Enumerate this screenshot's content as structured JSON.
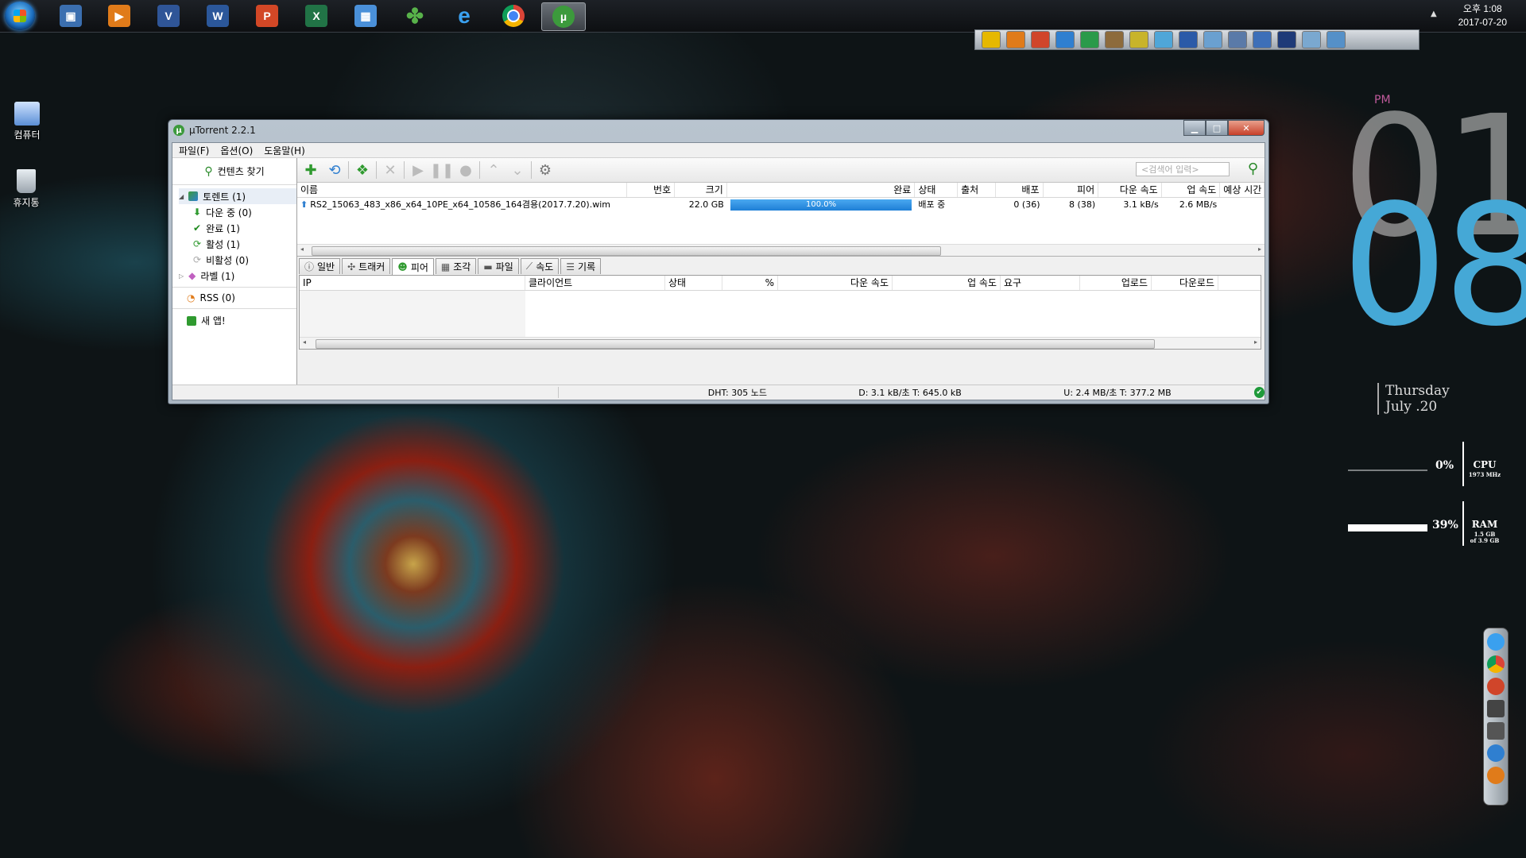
{
  "taskbar": {
    "clock_time": "오후 1:08",
    "clock_date": "2017-07-20",
    "pinned": [
      {
        "name": "computer",
        "glyph": "▣",
        "color": "#3b6fb0"
      },
      {
        "name": "media-player",
        "glyph": "▶",
        "color": "#e07b1a"
      },
      {
        "name": "visio",
        "glyph": "V",
        "color": "#2f5597"
      },
      {
        "name": "word",
        "glyph": "W",
        "color": "#2b579a"
      },
      {
        "name": "powerpoint",
        "glyph": "P",
        "color": "#d24726"
      },
      {
        "name": "excel",
        "glyph": "X",
        "color": "#217346"
      },
      {
        "name": "notes",
        "glyph": "▦",
        "color": "#4a90d9"
      },
      {
        "name": "clover",
        "glyph": "✤",
        "color": "#58b24a"
      },
      {
        "name": "internet-explorer",
        "glyph": "e",
        "color": "#1e88e5"
      },
      {
        "name": "chrome",
        "glyph": "◎",
        "color": "#db4437"
      },
      {
        "name": "utorrent",
        "glyph": "µ",
        "color": "#3c9a3c"
      }
    ]
  },
  "desktop_icons": [
    {
      "label": "컴퓨터",
      "color": "#5b8fd6"
    },
    {
      "label": "휴지통",
      "color": "#9aa4ad"
    }
  ],
  "window": {
    "title": "µTorrent 2.2.1",
    "menu": [
      "파일(F)",
      "옵션(O)",
      "도움말(H)"
    ],
    "search_placeholder": "<검색어 입력>",
    "sidebar": {
      "find_content": "컨텐츠 찾기",
      "torrents": "토렌트 (1)",
      "downloading": "다운 중 (0)",
      "completed": "완료 (1)",
      "active": "활성 (1)",
      "inactive": "비활성 (0)",
      "labels": "라벨 (1)",
      "rss": "RSS (0)",
      "new_app": "새 앱!"
    },
    "columns": [
      "이름",
      "번호",
      "크기",
      "완료",
      "상태",
      "출처",
      "배포",
      "피어",
      "다운 속도",
      "업 속도",
      "예상 시간"
    ],
    "torrent": {
      "name": "RS2_15063_483_x86_x64_10PE_x64_10586_164겸용(2017.7.20).wim",
      "number": "",
      "size": "22.0 GB",
      "progress": 100,
      "progress_label": "100.0%",
      "status": "배포 중",
      "source": "",
      "seeds": "0 (36)",
      "peers": "8 (38)",
      "down_speed": "3.1 kB/s",
      "up_speed": "2.6 MB/s",
      "eta": ""
    },
    "tabs": [
      "일반",
      "트래커",
      "피어",
      "조각",
      "파일",
      "속도",
      "기록"
    ],
    "active_tab": "피어",
    "peer_columns": [
      "IP",
      "클라이언트",
      "상태",
      "%",
      "다운 속도",
      "업 속도",
      "요구",
      "업로드",
      "다운로드"
    ],
    "status": {
      "dht": "DHT: 305 노드",
      "down": "D: 3.1 kB/초 T: 645.0 kB",
      "up": "U: 2.4 MB/초 T: 377.2 MB"
    }
  },
  "clock_widget": {
    "ampm": "PM",
    "hour": "01",
    "minute": "08",
    "day": "Thursday",
    "date": "July .20"
  },
  "meters": {
    "cpu": {
      "percent_label": "0%",
      "percent": 0,
      "label": "CPU",
      "sub": "1973 MHz"
    },
    "ram": {
      "percent_label": "39%",
      "percent": 39,
      "label": "RAM",
      "sub1": "1.5 GB",
      "sub2": "of 3.9 GB"
    }
  }
}
